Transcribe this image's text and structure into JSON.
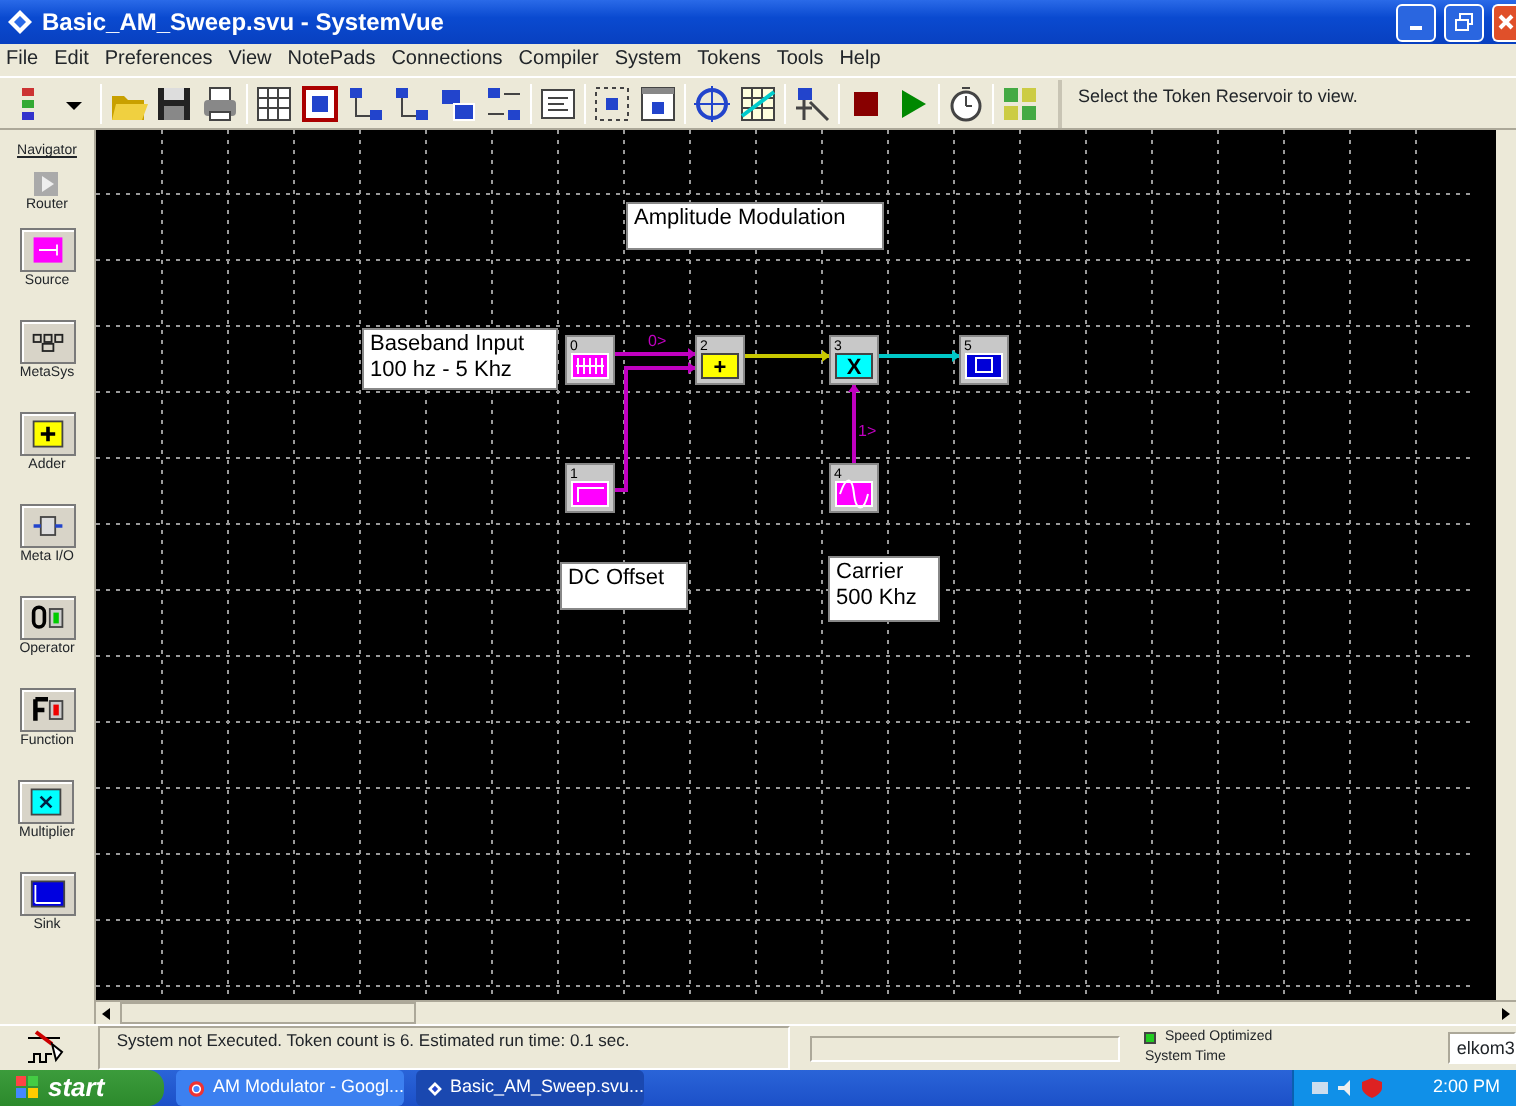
{
  "window": {
    "title": "Basic_AM_Sweep.svu - SystemVue"
  },
  "menu": [
    "File",
    "Edit",
    "Preferences",
    "View",
    "NotePads",
    "Connections",
    "Compiler",
    "System",
    "Tokens",
    "Tools",
    "Help"
  ],
  "toolbar_hint": "Select the Token Reservoir to view.",
  "navigator": {
    "title": "Navigator",
    "items": [
      {
        "label": "Router",
        "kind": "router"
      },
      {
        "label": "Source",
        "kind": "source"
      },
      {
        "label": "MetaSys",
        "kind": "metasys"
      },
      {
        "label": "Adder",
        "kind": "adder"
      },
      {
        "label": "Meta I/O",
        "kind": "metaio"
      },
      {
        "label": "Operator",
        "kind": "operator"
      },
      {
        "label": "Function",
        "kind": "function"
      },
      {
        "label": "Multiplier",
        "kind": "multiplier"
      },
      {
        "label": "Sink",
        "kind": "sink"
      }
    ]
  },
  "canvas": {
    "notes": [
      {
        "lines": [
          "Amplitude Modulation"
        ]
      },
      {
        "lines": [
          "Baseband Input",
          "100 hz - 5 Khz"
        ]
      },
      {
        "lines": [
          "DC Offset"
        ]
      },
      {
        "lines": [
          "Carrier",
          "500 Khz"
        ]
      }
    ],
    "tokens": [
      {
        "number": "0",
        "kind": "pulse"
      },
      {
        "number": "1",
        "kind": "step"
      },
      {
        "number": "2",
        "kind": "adder",
        "symbol": "+"
      },
      {
        "number": "3",
        "kind": "multiplier",
        "symbol": "X"
      },
      {
        "number": "4",
        "kind": "sine"
      },
      {
        "number": "5",
        "kind": "sink"
      }
    ],
    "wires": [
      {
        "color": "#c000c0",
        "label": "0>"
      },
      {
        "color": "#c000c0"
      },
      {
        "color": "#c8c800"
      },
      {
        "color": "#00c8c8"
      },
      {
        "color": "#c000c0",
        "label": "1>"
      }
    ]
  },
  "status_bar": {
    "message": "System not Executed. Token count is 6.  Estimated run time: 0.1 sec.",
    "mode": "Speed Optimized",
    "mode_on": true,
    "time_label": "System Time",
    "user": "elkom3"
  },
  "taskbar": {
    "start": "start",
    "tasks": [
      {
        "label": "AM Modulator - Googl...",
        "selected": false
      },
      {
        "label": "Basic_AM_Sweep.svu...",
        "selected": true
      }
    ],
    "clock": "2:00 PM"
  }
}
